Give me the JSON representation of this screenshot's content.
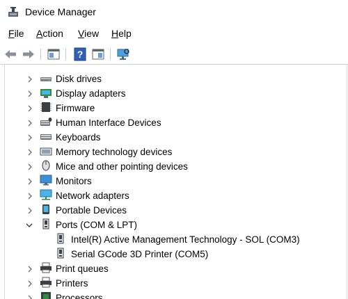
{
  "window": {
    "title": "Device Manager"
  },
  "menu": [
    {
      "label": "File",
      "accel": "F",
      "rest": "ile"
    },
    {
      "label": "Action",
      "accel": "A",
      "rest": "ction"
    },
    {
      "label": "View",
      "accel": "V",
      "rest": "iew"
    },
    {
      "label": "Help",
      "accel": "H",
      "rest": "elp"
    }
  ],
  "toolbar": {
    "buttons": [
      "back-arrow-icon",
      "forward-arrow-icon",
      "properties-window-icon",
      "help-icon",
      "properties-pane-icon",
      "scan-monitor-icon"
    ]
  },
  "tree": {
    "items": [
      {
        "label": "Disk drives",
        "icon": "disk-drive-icon",
        "expanded": false
      },
      {
        "label": "Display adapters",
        "icon": "display-adapter-icon",
        "expanded": false
      },
      {
        "label": "Firmware",
        "icon": "firmware-icon",
        "expanded": false
      },
      {
        "label": "Human Interface Devices",
        "icon": "hid-icon",
        "expanded": false
      },
      {
        "label": "Keyboards",
        "icon": "keyboard-icon",
        "expanded": false
      },
      {
        "label": "Memory technology devices",
        "icon": "memory-device-icon",
        "expanded": false
      },
      {
        "label": "Mice and other pointing devices",
        "icon": "mouse-icon",
        "expanded": false
      },
      {
        "label": "Monitors",
        "icon": "monitor-icon",
        "expanded": false
      },
      {
        "label": "Network adapters",
        "icon": "network-adapter-icon",
        "expanded": false
      },
      {
        "label": "Portable Devices",
        "icon": "portable-device-icon",
        "expanded": false
      },
      {
        "label": "Ports (COM & LPT)",
        "icon": "port-icon",
        "expanded": true
      },
      {
        "label": "Intel(R) Active Management Technology - SOL (COM3)",
        "icon": "port-icon",
        "child": true
      },
      {
        "label": "Serial GCode 3D Printer (COM5)",
        "icon": "port-icon",
        "child": true
      },
      {
        "label": "Print queues",
        "icon": "print-queue-icon",
        "expanded": false
      },
      {
        "label": "Printers",
        "icon": "printer-icon",
        "expanded": false
      },
      {
        "label": "Processors",
        "icon": "processor-icon",
        "expanded": false
      }
    ]
  }
}
